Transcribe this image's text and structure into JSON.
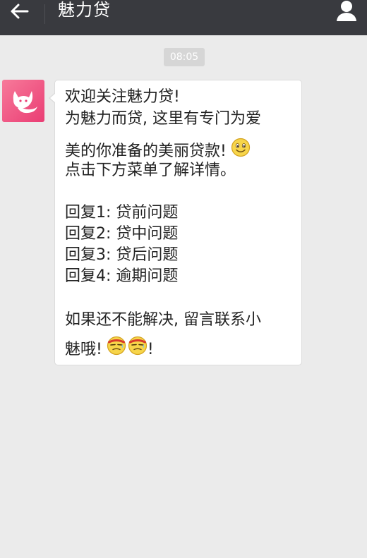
{
  "header": {
    "title": "魅力贷",
    "back_icon": "arrow-left-icon",
    "profile_icon": "person-icon",
    "background": "#393a3f"
  },
  "chat": {
    "timestamp": "08:05",
    "message": {
      "lines": [
        "欢迎关注魅力贷!",
        "为魅力而贷, 这里有专门为爱",
        "美的你准备的美丽贷款!",
        "点击下方菜单了解详情。",
        "回复1: 贷前问题",
        "回复2: 贷中问题",
        "回复3: 贷后问题",
        "回复4: 逾期问题",
        "如果还不能解决, 留言联系小",
        "魅哦!",
        "!"
      ],
      "emojis": [
        "smile-emoji",
        "cool-sweat-emoji",
        "cool-sweat-emoji"
      ]
    },
    "avatar_icon": "fox-logo-icon",
    "accent_color": "#ea3d74"
  }
}
